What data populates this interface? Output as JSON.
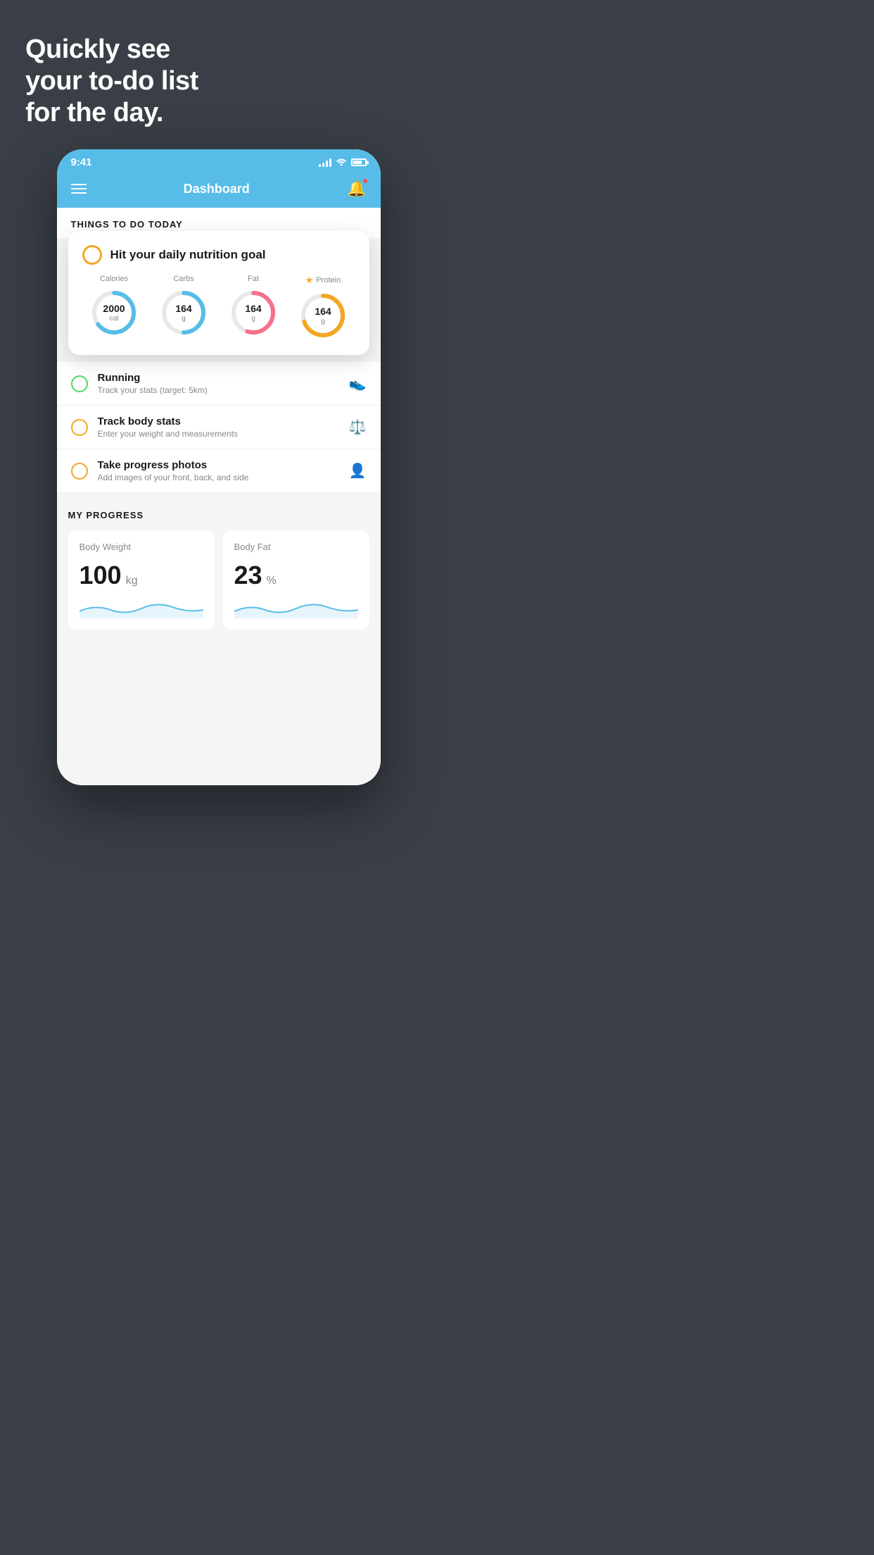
{
  "hero": {
    "title": "Quickly see\nyour to-do list\nfor the day."
  },
  "phone": {
    "statusBar": {
      "time": "9:41",
      "signalBars": 4,
      "wifi": true,
      "battery": 80
    },
    "navBar": {
      "title": "Dashboard",
      "hasNotification": true
    },
    "thingsHeader": "THINGS TO DO TODAY",
    "floatingCard": {
      "title": "Hit your daily nutrition goal",
      "nutrition": [
        {
          "label": "Calories",
          "value": "2000",
          "unit": "cal",
          "color": "#57bde8",
          "pct": 65
        },
        {
          "label": "Carbs",
          "value": "164",
          "unit": "g",
          "color": "#57bde8",
          "pct": 50
        },
        {
          "label": "Fat",
          "value": "164",
          "unit": "g",
          "color": "#f4728a",
          "pct": 55
        },
        {
          "label": "Protein",
          "value": "164",
          "unit": "g",
          "color": "#f5a623",
          "pct": 70,
          "star": true
        }
      ]
    },
    "todoItems": [
      {
        "id": "running",
        "title": "Running",
        "sub": "Track your stats (target: 5km)",
        "checked": true,
        "icon": "👟"
      },
      {
        "id": "body-stats",
        "title": "Track body stats",
        "sub": "Enter your weight and measurements",
        "checked": false,
        "icon": "⚖️"
      },
      {
        "id": "progress-photos",
        "title": "Take progress photos",
        "sub": "Add images of your front, back, and side",
        "checked": false,
        "icon": "👤"
      }
    ],
    "progress": {
      "sectionTitle": "MY PROGRESS",
      "cards": [
        {
          "title": "Body Weight",
          "value": "100",
          "unit": "kg"
        },
        {
          "title": "Body Fat",
          "value": "23",
          "unit": "%"
        }
      ]
    }
  }
}
